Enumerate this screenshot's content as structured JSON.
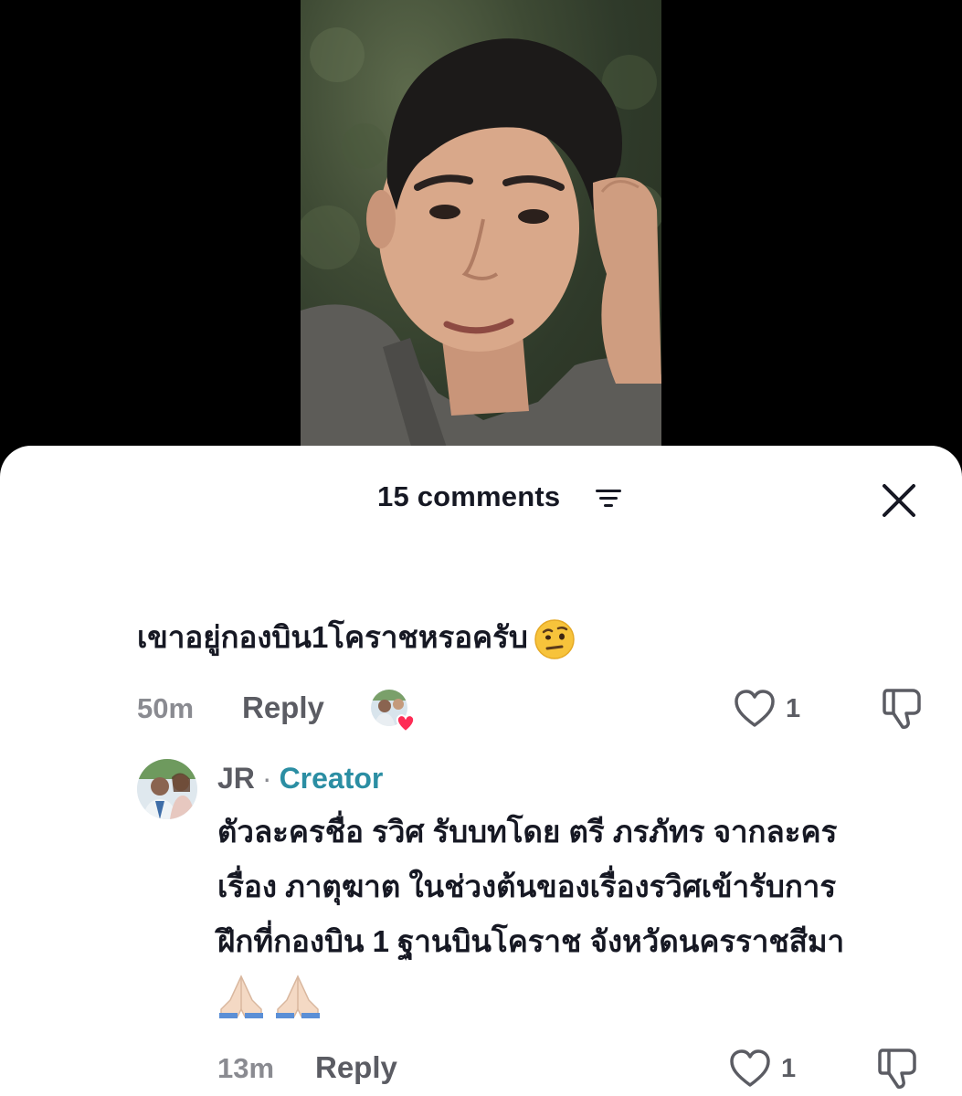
{
  "header": {
    "comment_count_label": "15 comments"
  },
  "comment": {
    "text": "เขาอยู่กองบิน1โคราชหรอครับ",
    "emoji_icon": "raised-eyebrow-face-icon",
    "time": "50m",
    "reply_label": "Reply",
    "like_count": "1"
  },
  "reply": {
    "author": "JR",
    "separator": "·",
    "badge": "Creator",
    "text_lines": [
      "ตัวละครชื่อ รวิศ รับบทโดย ตรี ภรภัทร จากละคร",
      "เรื่อง ภาตุฆาต ในช่วงต้นของเรื่องรวิศเข้ารับการ",
      "ฝึกที่กองบิน 1 ฐานบินโคราช จังหวัดนครราชสีมา"
    ],
    "emoji_icons": [
      "folded-hands-icon",
      "folded-hands-icon"
    ],
    "time": "13m",
    "reply_label": "Reply",
    "like_count": "1"
  },
  "colors": {
    "text_primary": "#161823",
    "text_secondary": "#8a8b91",
    "creator_badge": "#2b8ea3",
    "heart": "#fe2c55"
  }
}
